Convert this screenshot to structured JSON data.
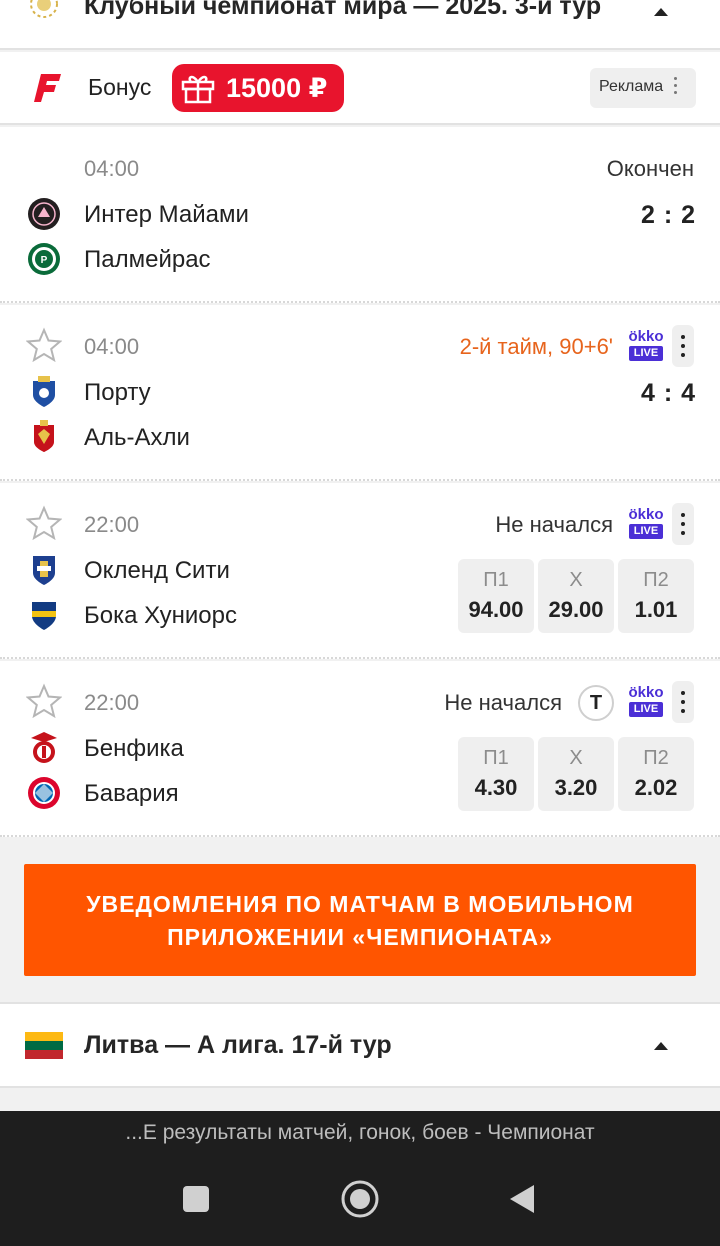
{
  "league": {
    "title": "Клубный чемпионат мира — 2025. 3-й тур"
  },
  "bonus": {
    "label": "Бонус",
    "amount": "15000 ₽",
    "ad_label": "Реклама"
  },
  "matches": [
    {
      "time": "04:00",
      "status": "Окончен",
      "home": "Интер Майами",
      "away": "Палмейрас",
      "score": "2 : 2"
    },
    {
      "time": "04:00",
      "status": "2-й тайм, 90+6'",
      "home": "Порту",
      "away": "Аль-Ахли",
      "score": "4 : 4",
      "broadcaster": {
        "top": "ökko",
        "bottom": "LIVE"
      }
    },
    {
      "time": "22:00",
      "status": "Не начался",
      "home": "Окленд Сити",
      "away": "Бока Хуниорс",
      "broadcaster": {
        "top": "ökko",
        "bottom": "LIVE"
      },
      "odds": [
        {
          "label": "П1",
          "value": "94.00"
        },
        {
          "label": "Х",
          "value": "29.00"
        },
        {
          "label": "П2",
          "value": "1.01"
        }
      ]
    },
    {
      "time": "22:00",
      "status": "Не начался",
      "home": "Бенфика",
      "away": "Бавария",
      "tv_badge": "T",
      "broadcaster": {
        "top": "ökko",
        "bottom": "LIVE"
      },
      "odds": [
        {
          "label": "П1",
          "value": "4.30"
        },
        {
          "label": "Х",
          "value": "3.20"
        },
        {
          "label": "П2",
          "value": "2.02"
        }
      ]
    }
  ],
  "cta": {
    "line1": "УВЕДОМЛЕНИЯ ПО МАТЧАМ В МОБИЛЬНОМ",
    "line2": "ПРИЛОЖЕНИИ «ЧЕМПИОНАТА»"
  },
  "league2": {
    "title": "Литва — А лига. 17-й тур"
  },
  "browser": {
    "caption": "...Е результаты матчей, гонок, боев - Чемпионат"
  },
  "colors": {
    "accent": "#ff5500",
    "bonus": "#e8142d",
    "live": "#e7641c",
    "okko": "#4b2fd6"
  },
  "icons": [
    "trophy-icon",
    "caret-up-icon",
    "fonbet-logo-icon",
    "gift-icon",
    "kebab-icon",
    "star-icon",
    "okko-live-icon",
    "tv-t-icon",
    "lithuania-flag-icon",
    "recent-apps-icon",
    "home-icon",
    "back-icon"
  ]
}
